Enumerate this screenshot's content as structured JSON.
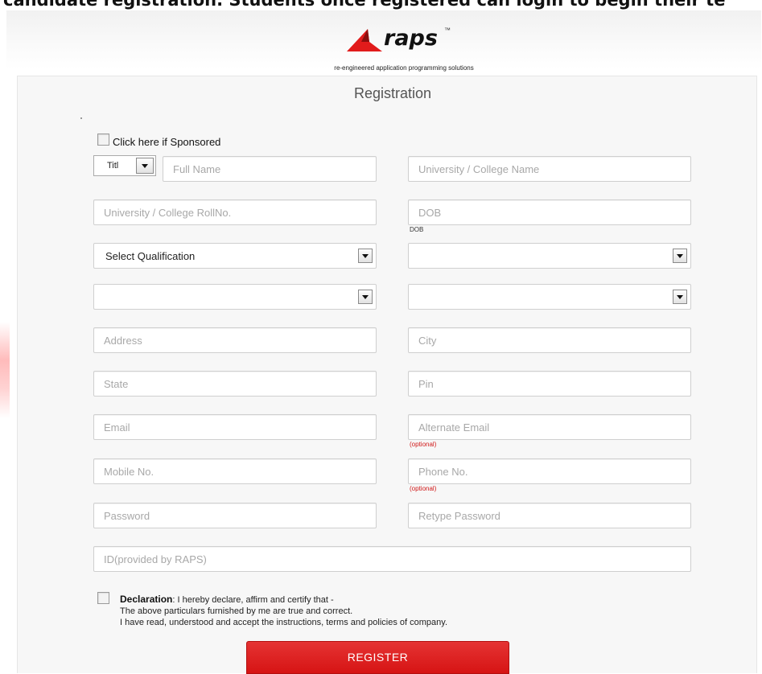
{
  "page": {
    "top_caption": "candidate registration. Students once registered can login to begin their te"
  },
  "brand": {
    "name": "raps",
    "trademark": "™",
    "tagline": "re-engineered application programming solutions",
    "accent_color": "#e11b1b"
  },
  "form": {
    "title": "Registration",
    "sponsored_label": "Click here if Sponsored",
    "title_select_value": "Titl",
    "fields": {
      "full_name": "Full Name",
      "university_name": "University / College Name",
      "roll_no": "University / College RollNo.",
      "dob": "DOB",
      "address": "Address",
      "city": "City",
      "state": "State",
      "pin": "Pin",
      "email": "Email",
      "alternate_email": "Alternate Email",
      "mobile": "Mobile No.",
      "phone": "Phone No.",
      "password": "Password",
      "retype_password": "Retype Password",
      "raps_id": "ID(provided by RAPS)"
    },
    "qualification_select": "Select Qualification",
    "dob_hint": "DOB",
    "optional_hint": "(optional)",
    "declaration": {
      "label": "Declaration",
      "line1": ": I hereby declare, affirm and certify that -",
      "line2": "The above particulars furnished by me are true and correct.",
      "line3": "I have read, understood and accept the instructions, terms and policies of company."
    },
    "register_label": "REGISTER"
  }
}
